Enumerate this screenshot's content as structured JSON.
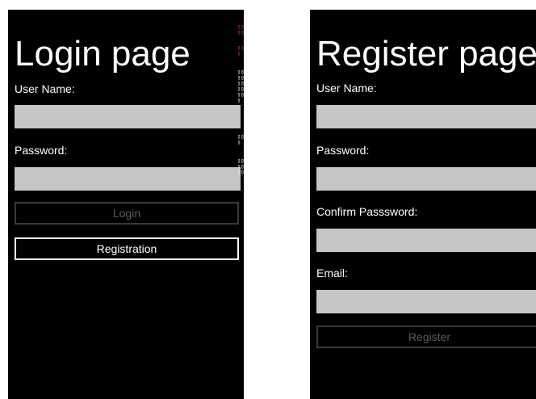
{
  "login": {
    "title": "Login page",
    "username_label": "User Name:",
    "password_label": "Password:",
    "login_button": "Login",
    "registration_button": "Registration"
  },
  "register": {
    "title": "Register page",
    "username_label": "User Name:",
    "password_label": "Password:",
    "confirm_label": "Confirm Passsword:",
    "email_label": "Email:",
    "register_button": "Register"
  },
  "colors": {
    "screen_background": "#000000",
    "field_background": "#c5c5c5",
    "disabled_border": "#3a3a3a",
    "enabled_border": "#ffffff"
  }
}
